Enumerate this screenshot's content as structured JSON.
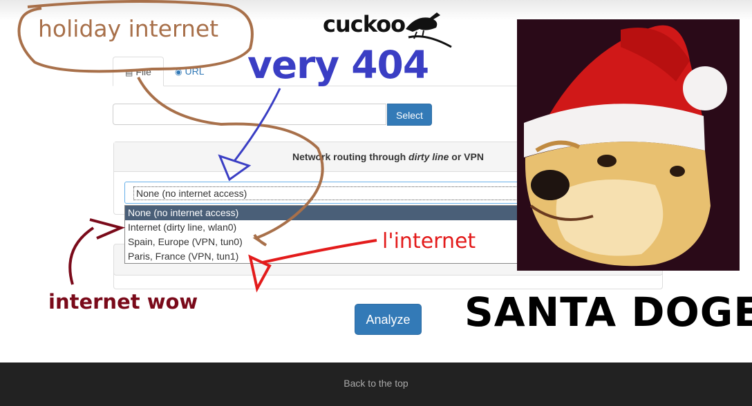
{
  "brand": {
    "logo_text": "cuckoo"
  },
  "tabs": [
    {
      "label": "File",
      "icon": "file-icon"
    },
    {
      "label": "URL",
      "icon": "globe-icon"
    }
  ],
  "upload": {
    "select_label": "Select",
    "file_value": ""
  },
  "routing": {
    "heading_prefix": "Network routing through ",
    "heading_em": "dirty line",
    "heading_suffix": " or VPN",
    "selected": "None (no internet access)",
    "options": [
      "None (no internet access)",
      "Internet (dirty line, wlan0)",
      "Spain, Europe (VPN, tun0)",
      "Paris, France (VPN, tun1)"
    ]
  },
  "analyze_label": "Analyze",
  "footer": {
    "back_to_top": "Back to the top"
  },
  "annotations": {
    "holiday": "holiday internet",
    "very": "very 404",
    "linternet": "l'internet",
    "wow": "internet wow",
    "santa": "SANTA DOGE"
  },
  "colors": {
    "primary": "#337ab7",
    "footer_bg": "#222222",
    "annotation_brown": "#a8704a",
    "annotation_blue": "#3a3ec4",
    "annotation_red": "#e31b1b",
    "annotation_darkred": "#7a0a1a"
  }
}
